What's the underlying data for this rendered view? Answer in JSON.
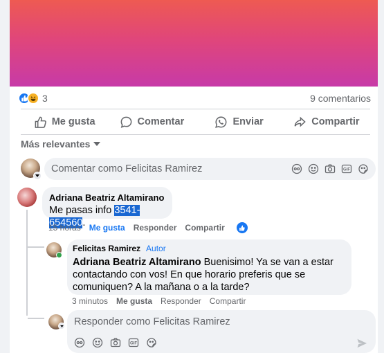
{
  "post": {
    "reactions_count": "3",
    "comments_count": "9 comentarios"
  },
  "actions": {
    "like": "Me gusta",
    "comment": "Comentar",
    "send": "Enviar",
    "share": "Compartir"
  },
  "sort_label": "Más relevantes",
  "compose_placeholder": "Comentar como Felicitas Ramirez",
  "comments": [
    {
      "author": "Adriana Beatriz Altamirano",
      "text_prefix": "Me pasas info ",
      "text_highlight": "3541-654560",
      "text_suffix": ".",
      "time": "15 horas",
      "like": "Me gusta",
      "reply": "Responder",
      "share": "Compartir"
    }
  ],
  "reply": {
    "author": "Felicitas Ramirez",
    "badge": "Autor",
    "mention": "Adriana Beatriz Altamirano",
    "text": " Buenisimo! Ya se van a estar contactando con vos! En que horario preferis que se comuniquen? A la mañana o a la tarde?",
    "time": "3 minutos",
    "like": "Me gusta",
    "reply": "Responder",
    "share": "Compartir"
  },
  "reply_placeholder": "Responder como Felicitas Ramirez",
  "colors": {
    "accent": "#1877f2",
    "highlight": "#1967d2",
    "online": "#31a24c"
  }
}
